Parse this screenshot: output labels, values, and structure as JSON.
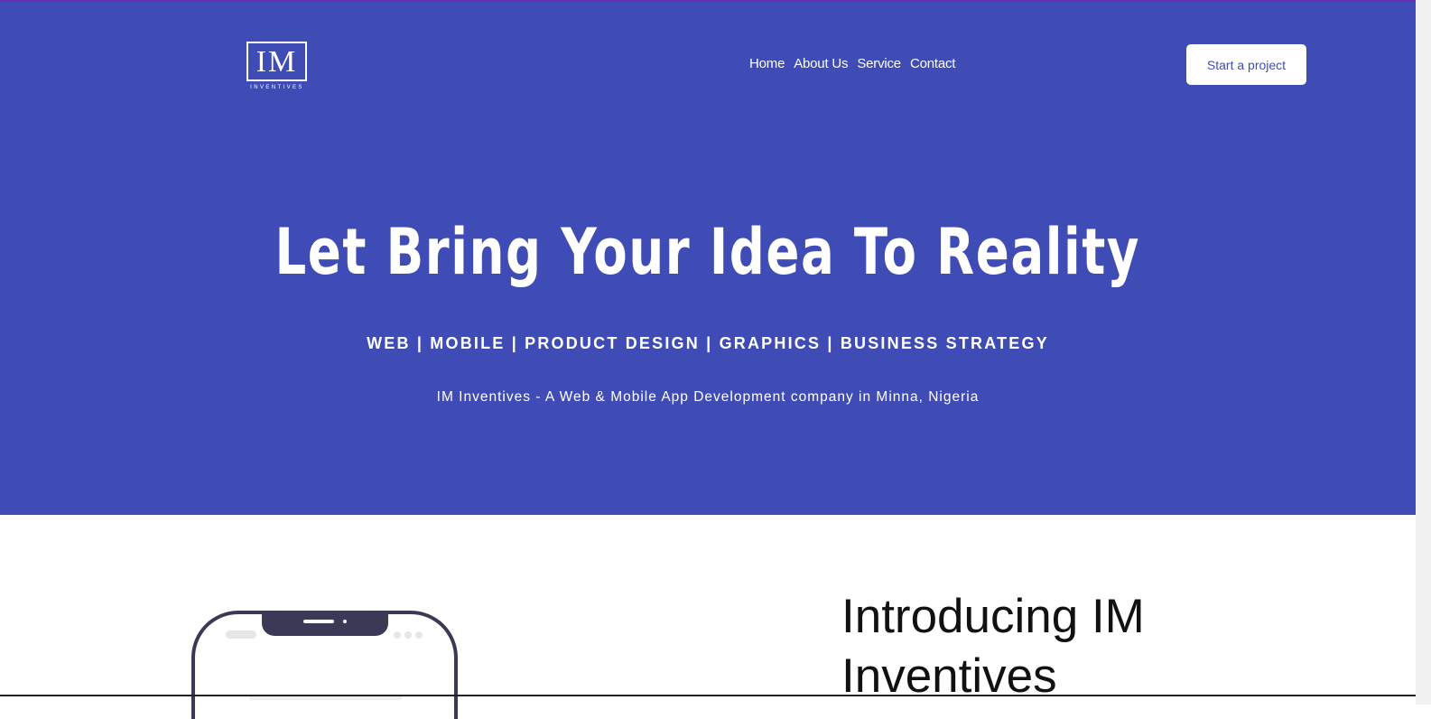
{
  "brand": {
    "logo_mark": "IM",
    "logo_sub": "INVENTIVES"
  },
  "nav": {
    "items": [
      "Home",
      "About Us",
      "Service",
      "Contact"
    ]
  },
  "cta": {
    "label": "Start a project"
  },
  "hero": {
    "headline": "Let Bring Your Idea To Reality",
    "services": "WEB | MOBILE | PRODUCT DESIGN | GRAPHICS | BUSINESS STRATEGY",
    "tagline": "IM Inventives - A Web & Mobile App Development company in Minna, Nigeria"
  },
  "intro": {
    "title": "Introducing IM Inventives"
  },
  "colors": {
    "hero_bg": "#404cb6",
    "accent_border": "#6a2fb0",
    "phone_frame": "#3a3a56"
  },
  "icons": {
    "phone": "smartphone-illustration"
  }
}
